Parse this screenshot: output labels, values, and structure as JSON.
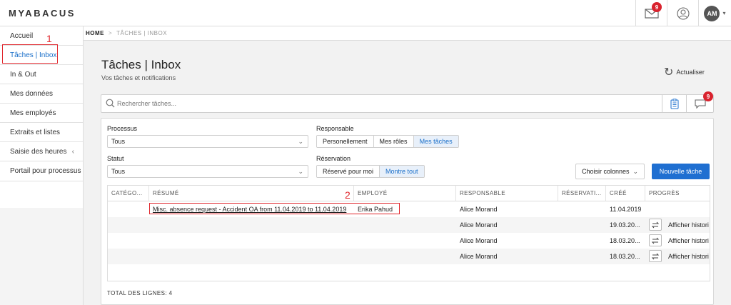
{
  "app": {
    "logo_text": "MYABACUS"
  },
  "topbar": {
    "mail_badge": "9",
    "avatar_initials": "AM"
  },
  "sidebar": {
    "items": [
      {
        "label": "Accueil"
      },
      {
        "label": "Tâches | Inbox"
      },
      {
        "label": "In & Out"
      },
      {
        "label": "Mes données"
      },
      {
        "label": "Mes employés"
      },
      {
        "label": "Extraits et listes"
      },
      {
        "label": "Saisie des heures"
      },
      {
        "label": "Portail pour processus"
      }
    ],
    "expand_icon": "chevron-left-icon"
  },
  "annotations": {
    "marker1": "1",
    "marker2": "2"
  },
  "breadcrumb": {
    "home": "HOME",
    "separator": ">",
    "current": "TÂCHES | INBOX"
  },
  "page": {
    "title": "Tâches | Inbox",
    "subtitle": "Vos tâches et notifications",
    "refresh_label": "Actualiser"
  },
  "search": {
    "placeholder": "Rechercher tâches...",
    "value": "",
    "notification_badge": "9"
  },
  "filters": {
    "processus": {
      "label": "Processus",
      "selected": "Tous"
    },
    "statut": {
      "label": "Statut",
      "selected": "Tous"
    },
    "responsable": {
      "label": "Responsable",
      "options": [
        "Personellement",
        "Mes rôles",
        "Mes tâches"
      ],
      "active": "Mes tâches"
    },
    "reservation": {
      "label": "Réservation",
      "options": [
        "Réservé pour moi",
        "Montre tout"
      ],
      "active": "Montre tout"
    }
  },
  "actions": {
    "choose_columns": "Choisir colonnes",
    "new_task": "Nouvelle tâche"
  },
  "table": {
    "headers": [
      "CATÉGO...",
      "RÉSUMÉ",
      "EMPLOYÉ",
      "RESPONSABLE",
      "RÉSERVATI...",
      "CRÉÉ",
      "PROGRÈS"
    ],
    "rows": [
      {
        "category": "",
        "summary": "Misc. absence request - Accident OA from 11.04.2019 to 11.04.2019",
        "employee": "Erika Pahud",
        "responsible": "Alice Morand",
        "reservation": "",
        "created": "11.04.2019",
        "progress": ""
      },
      {
        "category": "",
        "summary": "",
        "employee": "",
        "responsible": "Alice Morand",
        "reservation": "",
        "created": "19.03.20...",
        "progress": "Afficher histori"
      },
      {
        "category": "",
        "summary": "",
        "employee": "",
        "responsible": "Alice Morand",
        "reservation": "",
        "created": "18.03.20...",
        "progress": "Afficher histori"
      },
      {
        "category": "",
        "summary": "",
        "employee": "",
        "responsible": "Alice Morand",
        "reservation": "",
        "created": "18.03.20...",
        "progress": "Afficher histori"
      }
    ],
    "total_label": "TOTAL DES LIGNES: 4"
  },
  "colors": {
    "accent": "#1f6fd1",
    "badge": "#d9232e",
    "annotation": "#e0282e"
  }
}
